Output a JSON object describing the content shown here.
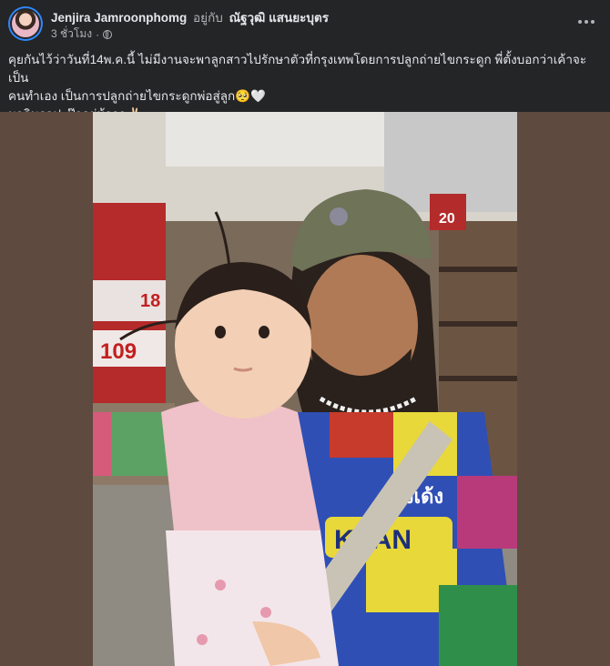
{
  "post": {
    "author_name": "Jenjira Jamroonphomg",
    "with_label": "อยู่กับ",
    "tagged_name": "ณัฐวุฒิ แสนยะบุตร",
    "timestamp": "3 ชั่วโมง",
    "privacy_icon": "globe-icon",
    "text_line_1": "คุยกันไว้ว่าวันที่14พ.ค.นี้ ไม่มีงานจะพาลูกสาวไปรักษาตัวที่กรุงเทพโดยการปลูกถ่ายไขกระดูก พี่ตั้งบอกว่าเค้าจะเป็น",
    "text_line_2": "คนทำเอง เป็นการปลูกถ่ายไขกระดูกพ่อสู่ลูก🥺🤍",
    "text_line_3": " มาลินรอปะป๊าอยู่น้าาา✌🏻",
    "more_icon": "more-options-icon"
  },
  "photo": {
    "sign_1": "18",
    "sign_2": "109",
    "sign_3": "20",
    "shirt_text_1": "เด้งเด้ง",
    "shirt_text_2": "KEAN"
  },
  "colors": {
    "background": "#242526",
    "text_primary": "#e4e6eb",
    "text_secondary": "#b0b3b8",
    "avatar_ring": "#2d88ff"
  }
}
